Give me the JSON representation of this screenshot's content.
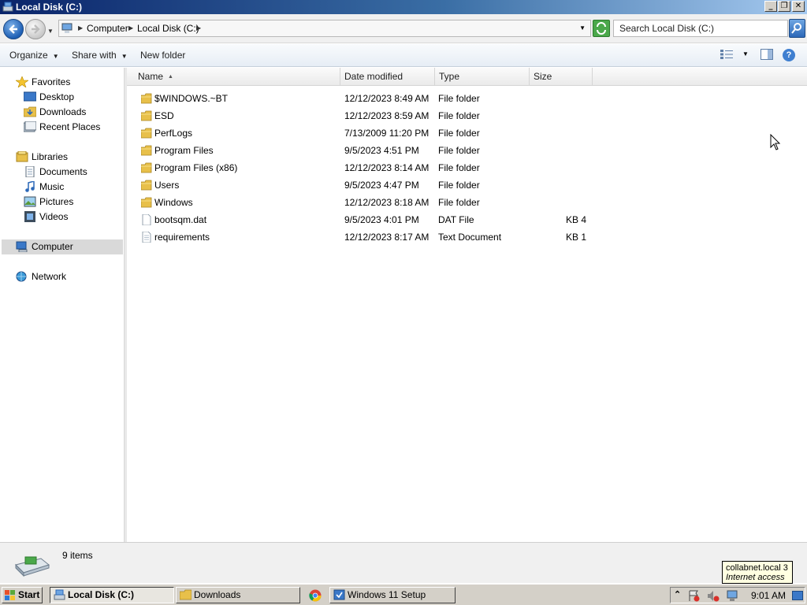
{
  "window": {
    "title": "Local Disk (C:)"
  },
  "address": {
    "crumbs": [
      "Computer",
      "Local Disk (C:)"
    ]
  },
  "search": {
    "placeholder": "Search Local Disk (C:)"
  },
  "toolbar": {
    "organize": "Organize",
    "share_with": "Share with",
    "new_folder": "New folder"
  },
  "nav": {
    "favorites": "Favorites",
    "desktop": "Desktop",
    "downloads": "Downloads",
    "recent_places": "Recent Places",
    "libraries": "Libraries",
    "documents": "Documents",
    "music": "Music",
    "pictures": "Pictures",
    "videos": "Videos",
    "computer": "Computer",
    "network": "Network"
  },
  "columns": {
    "name": "Name",
    "date_modified": "Date modified",
    "type": "Type",
    "size": "Size"
  },
  "files": [
    {
      "name": "$WINDOWS.~BT",
      "date": "12/12/2023 8:49 AM",
      "type": "File folder",
      "size": "",
      "icon": "folder-icon"
    },
    {
      "name": "ESD",
      "date": "12/12/2023 8:59 AM",
      "type": "File folder",
      "size": "",
      "icon": "folder-icon"
    },
    {
      "name": "PerfLogs",
      "date": "7/13/2009 11:20 PM",
      "type": "File folder",
      "size": "",
      "icon": "folder-icon"
    },
    {
      "name": "Program Files",
      "date": "9/5/2023 4:51 PM",
      "type": "File folder",
      "size": "",
      "icon": "folder-icon"
    },
    {
      "name": "Program Files (x86)",
      "date": "12/12/2023 8:14 AM",
      "type": "File folder",
      "size": "",
      "icon": "folder-icon"
    },
    {
      "name": "Users",
      "date": "9/5/2023 4:47 PM",
      "type": "File folder",
      "size": "",
      "icon": "folder-icon"
    },
    {
      "name": "Windows",
      "date": "12/12/2023 8:18 AM",
      "type": "File folder",
      "size": "",
      "icon": "folder-icon"
    },
    {
      "name": "bootsqm.dat",
      "date": "9/5/2023 4:01 PM",
      "type": "DAT File",
      "size": "4 KB",
      "icon": "file-icon"
    },
    {
      "name": "requirements",
      "date": "12/12/2023 8:17 AM",
      "type": "Text Document",
      "size": "1 KB",
      "icon": "text-file-icon"
    }
  ],
  "status": {
    "count": "9 items"
  },
  "tooltip": {
    "line1": "collabnet.local  3",
    "line2": "Internet access"
  },
  "taskbar": {
    "start": "Start",
    "tasks": [
      "Local Disk (C:)",
      "Downloads",
      "Windows 11 Setup"
    ],
    "clock": "9:01 AM"
  },
  "colors": {
    "accent": "#0a246a",
    "folder": "#e8c04a"
  }
}
